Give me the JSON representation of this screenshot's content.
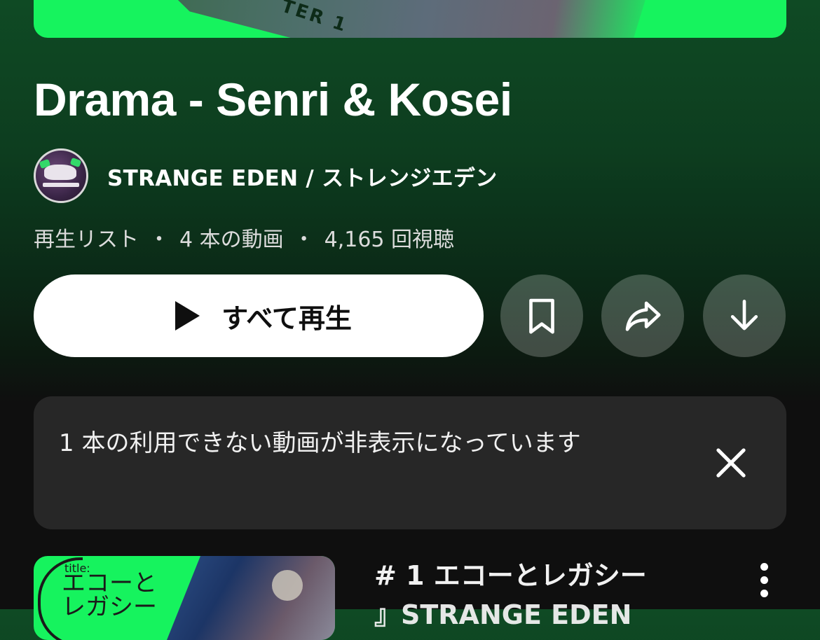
{
  "hero": {
    "chapter_text": "TER 1"
  },
  "playlist": {
    "title": "Drama - Senri & Kosei",
    "channel": "STRANGE EDEN / ストレンジエデン",
    "meta": {
      "type": "再生リスト",
      "video_count": "4 本の動画",
      "views": "4,165 回視聴"
    },
    "separator": "・"
  },
  "actions": {
    "play_all_label": "すべて再生",
    "play_icon": "play-icon",
    "save_icon": "bookmark-icon",
    "share_icon": "share-icon",
    "download_icon": "download-icon"
  },
  "notice": {
    "message": "1 本の利用できない動画が非表示になっています",
    "close_icon": "close-icon"
  },
  "videos": [
    {
      "title_line1": "# 1 エコーとレガシー",
      "title_line2": "』STRANGE EDEN",
      "thumb_label": "title:",
      "thumb_title": "エコーと\nレガシー"
    }
  ],
  "colors": {
    "accent_green": "#16f35e",
    "background": "#0f0f0f",
    "card": "#272727"
  }
}
